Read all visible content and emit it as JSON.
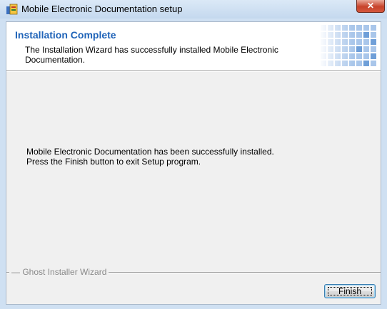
{
  "window": {
    "title": "Mobile Electronic Documentation setup",
    "close_label": "✕",
    "icon": "installer-icon"
  },
  "header": {
    "title": "Installation Complete",
    "description": "The Installation Wizard has successfully installed Mobile Electronic Documentation."
  },
  "body": {
    "line1": "Mobile Electronic Documentation has been successfully installed.",
    "line2": "Press the Finish button to exit Setup program."
  },
  "footer": {
    "group_label": "Ghost Installer Wizard",
    "finish_label": "Finish"
  },
  "colors": {
    "title_blue": "#1f63b8",
    "dialog_bg": "#f0f0f0"
  }
}
